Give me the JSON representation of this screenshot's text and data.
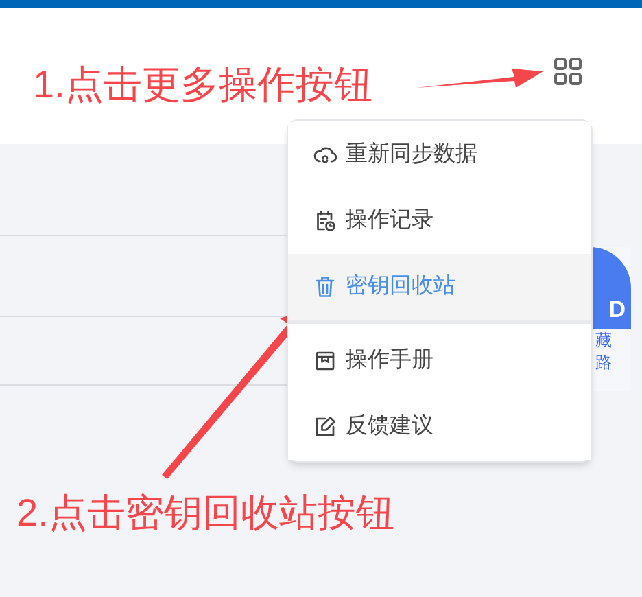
{
  "annotations": [
    {
      "text": "1.点击更多操作按钮"
    },
    {
      "text": "2.点击密钥回收站按钮"
    }
  ],
  "side_card": {
    "badge": "D",
    "lines": [
      "藏",
      "路"
    ]
  },
  "menu": {
    "items": [
      {
        "kind": "cloud",
        "label": "重新同步数据",
        "selected": false
      },
      {
        "kind": "history",
        "label": "操作记录",
        "selected": false
      },
      {
        "kind": "trash",
        "label": "密钥回收站",
        "selected": true
      },
      {
        "kind": "book",
        "label": "操作手册",
        "selected": false,
        "divider_before": true
      },
      {
        "kind": "edit",
        "label": "反馈建议",
        "selected": false
      }
    ]
  }
}
